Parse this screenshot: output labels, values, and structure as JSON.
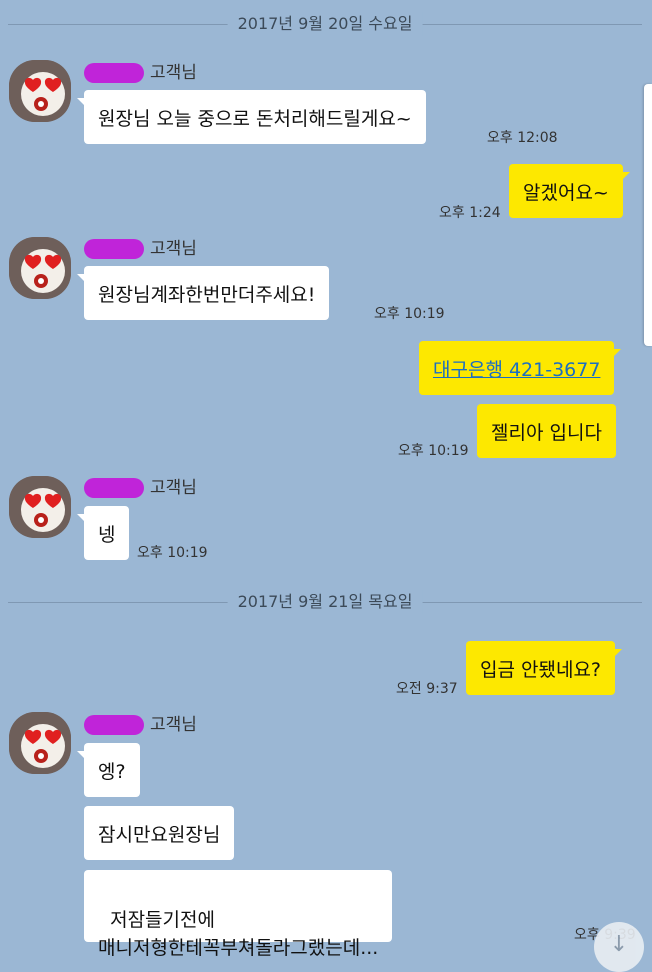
{
  "dates": [
    "2017년 9월 20일 수요일",
    "2017년 9월 21일 목요일"
  ],
  "sender_label": "고객님",
  "messages": [
    {
      "text": "원장님 오늘 중으로 돈처리해드릴게요~",
      "time": "오후 12:08"
    },
    {
      "text": "알겠어요~",
      "time": "오후 1:24"
    },
    {
      "text": "원장님계좌한번만더주세요!",
      "time": "오후 10:19"
    },
    {
      "text": "대구은행 421-3677"
    },
    {
      "text": "젤리아 입니다",
      "time": "오후 10:19"
    },
    {
      "text": "넹",
      "time": "오후 10:19"
    },
    {
      "text": "입금 안됐네요?",
      "time": "오전 9:37"
    },
    {
      "text": "엥?"
    },
    {
      "text": "잠시만요원장님"
    },
    {
      "text": "저잠들기전에\n매니저형한테꼭부쳐돌라그랬는데...",
      "time": "오후 9:39"
    }
  ],
  "icons": {
    "avatar": "avatar-heart-eyes",
    "scroll_down": "arrow-down-icon"
  },
  "colors": {
    "background": "#9bb7d4",
    "incoming": "#ffffff",
    "outgoing": "#fde800",
    "link": "#1b6ec2",
    "scribble": "#c21bd9"
  }
}
